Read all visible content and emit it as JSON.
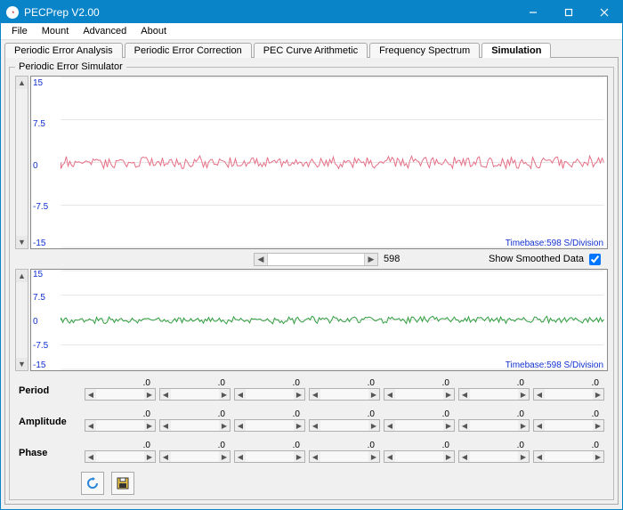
{
  "window": {
    "title": "PECPrep V2.00"
  },
  "menu": [
    "File",
    "Mount",
    "Advanced",
    "About"
  ],
  "tabs": [
    {
      "label": "Periodic Error Analysis"
    },
    {
      "label": "Periodic Error Correction"
    },
    {
      "label": "PEC Curve Arithmetic"
    },
    {
      "label": "Frequency Spectrum"
    },
    {
      "label": "Simulation",
      "active": true
    }
  ],
  "group_title": "Periodic Error Simulator",
  "chart_data": [
    {
      "type": "line",
      "ylim": [
        -15,
        15
      ],
      "yticks": [
        15.0,
        7.5,
        0,
        -7.5,
        -15.0
      ],
      "timebase_label": "Timebase:598 S/Division",
      "series_color": "#e67087",
      "description": "noisy trace centered around 0, amplitude approx ±0.8"
    },
    {
      "type": "line",
      "ylim": [
        -15,
        15
      ],
      "yticks": [
        15.0,
        7.5,
        0,
        -7.5,
        -15.0
      ],
      "timebase_label": "Timebase:598 S/Division",
      "series_color": "#2e9e3e",
      "description": "noisy trace centered around 0, amplitude approx ±0.6"
    }
  ],
  "mid": {
    "range_value": "598",
    "smooth_label": "Show Smoothed Data",
    "smooth_checked": true
  },
  "params": {
    "rows": [
      "Period",
      "Amplitude",
      "Phase"
    ],
    "values": [
      [
        ".0",
        ".0",
        ".0",
        ".0",
        ".0",
        ".0",
        ".0"
      ],
      [
        ".0",
        ".0",
        ".0",
        ".0",
        ".0",
        ".0",
        ".0"
      ],
      [
        ".0",
        ".0",
        ".0",
        ".0",
        ".0",
        ".0",
        ".0"
      ]
    ]
  },
  "buttons": {
    "refresh_icon": "refresh-icon",
    "save_icon": "save-icon"
  }
}
